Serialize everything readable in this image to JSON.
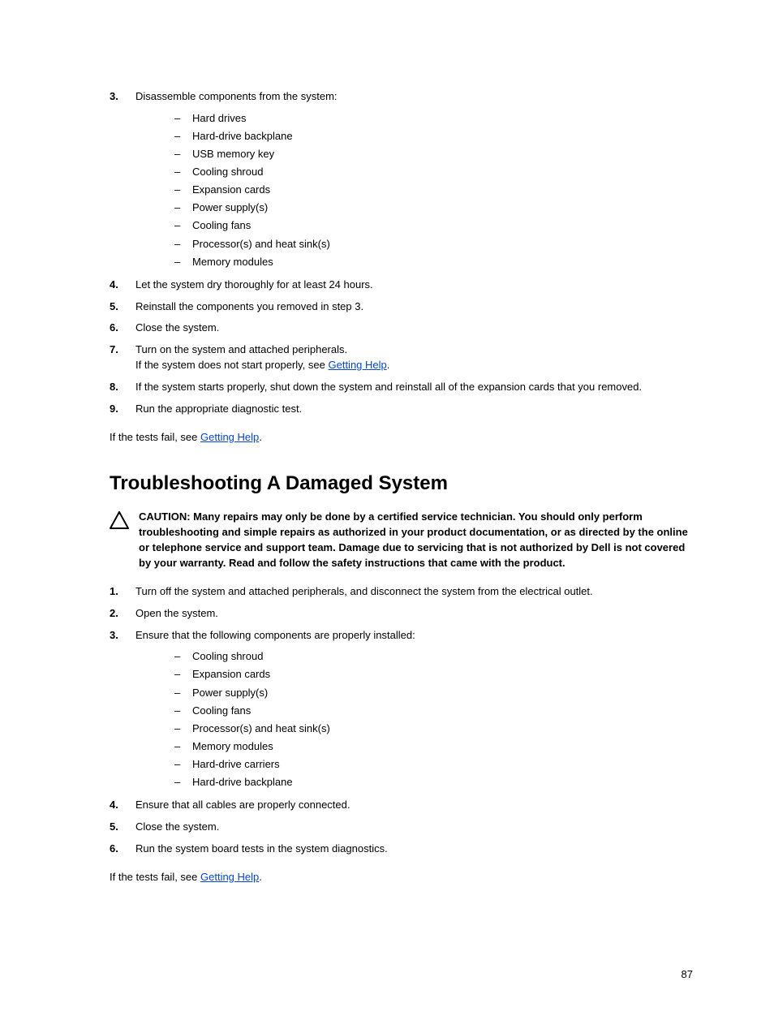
{
  "topList": {
    "item3": {
      "num": "3.",
      "text": "Disassemble components from the system:",
      "sub": [
        "Hard drives",
        "Hard-drive backplane",
        "USB memory key",
        "Cooling shroud",
        "Expansion cards",
        "Power supply(s)",
        "Cooling fans",
        "Processor(s) and heat sink(s)",
        "Memory modules"
      ]
    },
    "item4": {
      "num": "4.",
      "text": "Let the system dry thoroughly for at least 24 hours."
    },
    "item5": {
      "num": "5.",
      "text": "Reinstall the components you removed in step 3."
    },
    "item6": {
      "num": "6.",
      "text": "Close the system."
    },
    "item7": {
      "num": "7.",
      "line1": "Turn on the system and attached peripherals.",
      "line2a": "If the system does not start properly, see ",
      "line2link": "Getting Help",
      "line2b": "."
    },
    "item8": {
      "num": "8.",
      "text": "If the system starts properly, shut down the system and reinstall all of the expansion cards that you removed."
    },
    "item9": {
      "num": "9.",
      "text": "Run the appropriate diagnostic test."
    }
  },
  "topTrailing": {
    "pre": "If the tests fail, see ",
    "link": "Getting Help",
    "post": "."
  },
  "sectionTitle": "Troubleshooting A Damaged System",
  "caution": {
    "label": "CAUTION: ",
    "text": "Many repairs may only be done by a certified service technician. You should only perform troubleshooting and simple repairs as authorized in your product documentation, or as directed by the online or telephone service and support team. Damage due to servicing that is not authorized by Dell is not covered by your warranty. Read and follow the safety instructions that came with the product."
  },
  "bottomList": {
    "item1": {
      "num": "1.",
      "text": "Turn off the system and attached peripherals, and disconnect the system from the electrical outlet."
    },
    "item2": {
      "num": "2.",
      "text": "Open the system."
    },
    "item3": {
      "num": "3.",
      "text": "Ensure that the following components are properly installed:",
      "sub": [
        "Cooling shroud",
        "Expansion cards",
        "Power supply(s)",
        "Cooling fans",
        "Processor(s) and heat sink(s)",
        "Memory modules",
        "Hard-drive carriers",
        "Hard-drive backplane"
      ]
    },
    "item4": {
      "num": "4.",
      "text": "Ensure that all cables are properly connected."
    },
    "item5": {
      "num": "5.",
      "text": "Close the system."
    },
    "item6": {
      "num": "6.",
      "text": "Run the system board tests in the system diagnostics."
    }
  },
  "bottomTrailing": {
    "pre": "If the tests fail, see ",
    "link": "Getting Help",
    "post": "."
  },
  "pageNumber": "87"
}
